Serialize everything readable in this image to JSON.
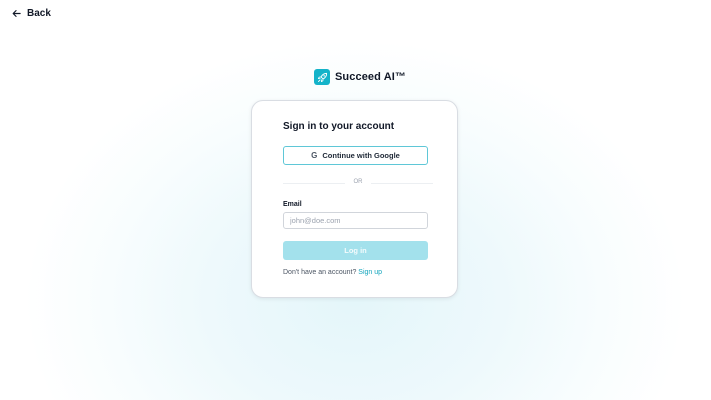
{
  "nav": {
    "back_icon": "arrow-left-icon",
    "back_label": "Back"
  },
  "brand": {
    "logo_icon": "rocket-icon",
    "name": "Succeed AI™",
    "accent_color": "#14b3c9"
  },
  "login": {
    "title": "Sign in to your account",
    "google_icon": "google-g-icon",
    "google_label": "Continue with Google",
    "divider_text": "OR",
    "email_label": "Email",
    "email_value": "",
    "email_placeholder": "john@doe.com",
    "submit_label": "Log in",
    "submit_color": "#a3e1ec",
    "signup_prompt": "Don't have an account?",
    "signup_link": "Sign up"
  }
}
